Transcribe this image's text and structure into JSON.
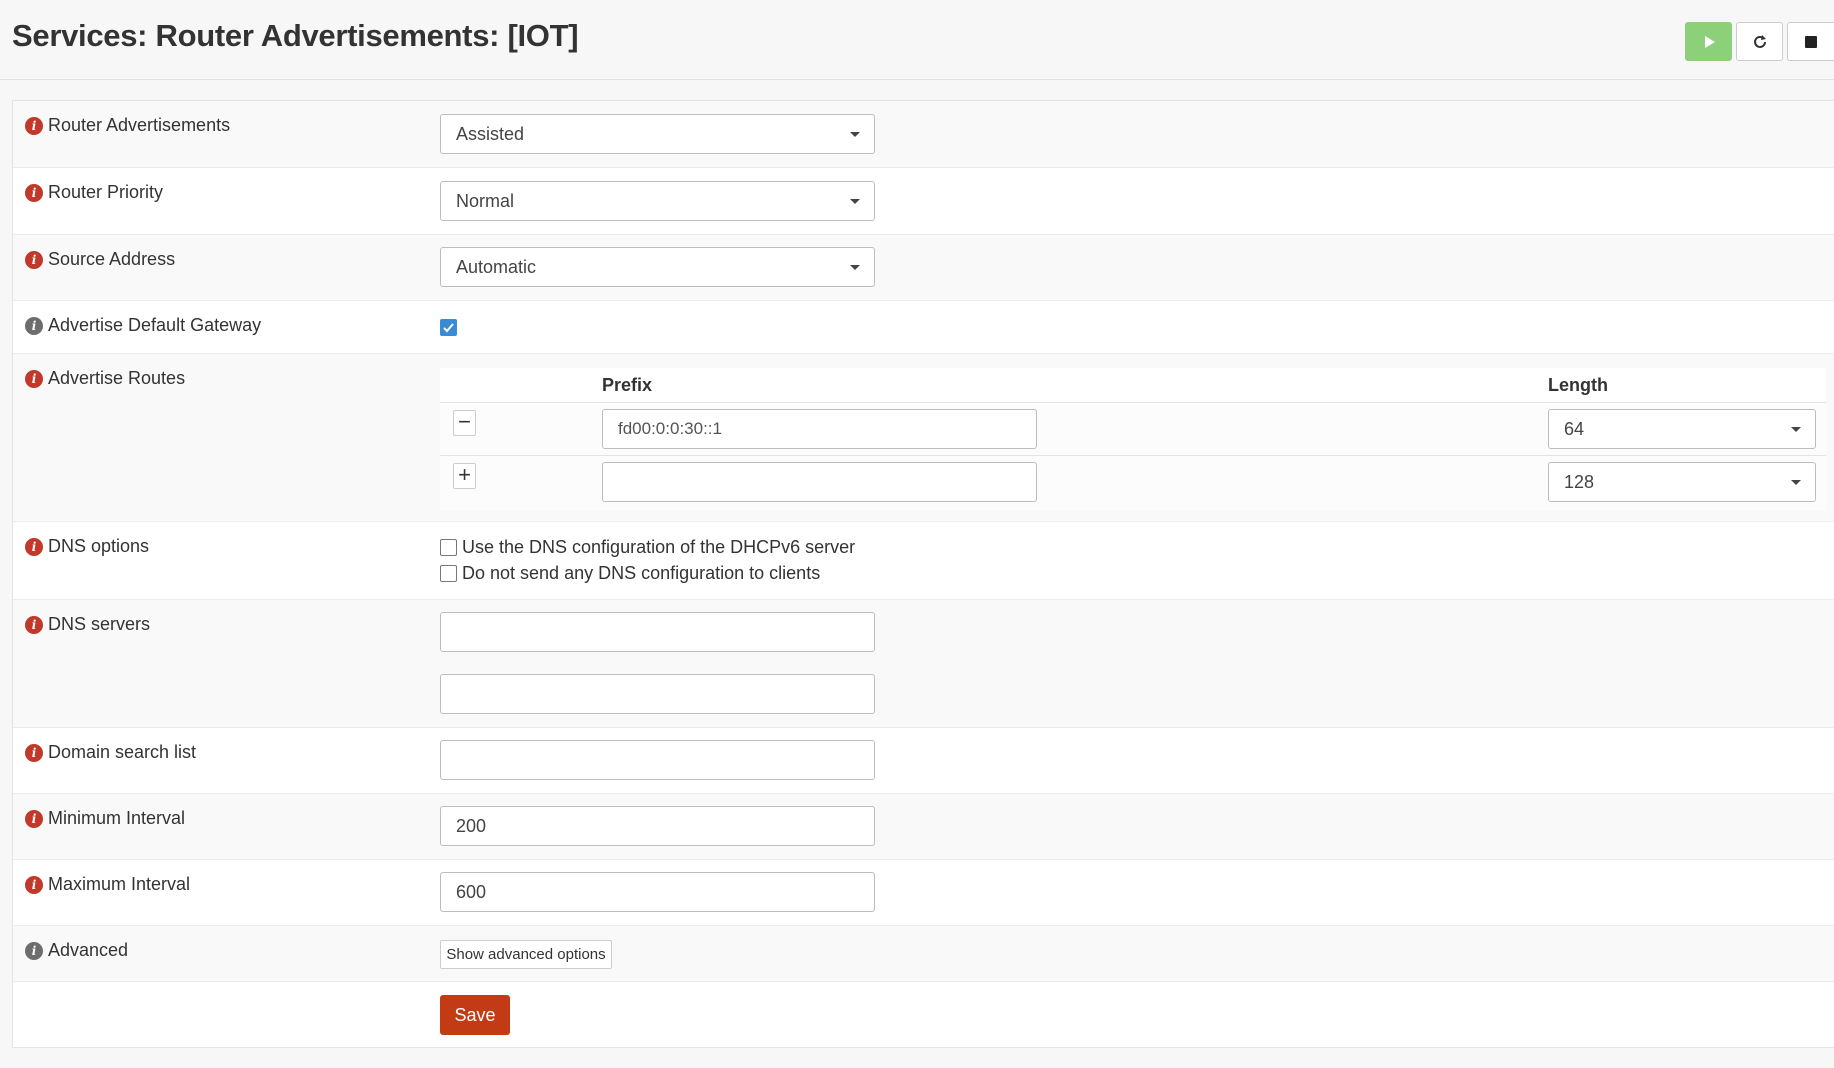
{
  "page": {
    "title": "Services: Router Advertisements: [IOT]"
  },
  "service_controls": {
    "start": "play-icon",
    "restart": "refresh-icon",
    "stop": "stop-icon"
  },
  "form": {
    "router_advertisements": {
      "label": "Router Advertisements",
      "value": "Assisted"
    },
    "router_priority": {
      "label": "Router Priority",
      "value": "Normal"
    },
    "source_address": {
      "label": "Source Address",
      "value": "Automatic"
    },
    "advertise_default_gateway": {
      "label": "Advertise Default Gateway",
      "checked": true
    },
    "advertise_routes": {
      "label": "Advertise Routes",
      "columns": [
        "Prefix",
        "Length"
      ],
      "rows": [
        {
          "action": "−",
          "prefix": "fd00:0:0:30::1",
          "length": "64"
        },
        {
          "action": "+",
          "prefix": "",
          "length": "128"
        }
      ]
    },
    "dns_options": {
      "label": "DNS options",
      "options": [
        {
          "label": "Use the DNS configuration of the DHCPv6 server",
          "checked": false
        },
        {
          "label": "Do not send any DNS configuration to clients",
          "checked": false
        }
      ]
    },
    "dns_servers": {
      "label": "DNS servers",
      "values": [
        "",
        ""
      ]
    },
    "domain_search_list": {
      "label": "Domain search list",
      "value": ""
    },
    "minimum_interval": {
      "label": "Minimum Interval",
      "value": "200"
    },
    "maximum_interval": {
      "label": "Maximum Interval",
      "value": "600"
    },
    "advanced": {
      "label": "Advanced",
      "button": "Show advanced options"
    },
    "save_label": "Save"
  },
  "colors": {
    "accent": "#c33b15",
    "start_button": "#8dd07a",
    "checkbox": "#3a8bd6",
    "info_icon": "#c0392b"
  }
}
